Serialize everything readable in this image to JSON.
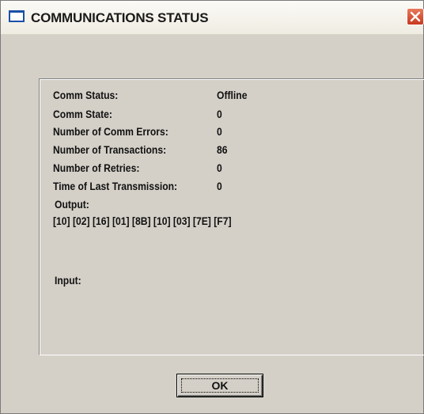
{
  "window": {
    "title": "COMMUNICATIONS STATUS",
    "close_icon": "close-icon"
  },
  "status": {
    "rows": [
      {
        "label": "Comm Status:",
        "value": "Offline"
      },
      {
        "label": "Comm State:",
        "value": "0"
      },
      {
        "label": "Number of Comm Errors:",
        "value": "0"
      },
      {
        "label": "Number of Transactions:",
        "value": "86"
      },
      {
        "label": "Number of Retries:",
        "value": "0"
      },
      {
        "label": "Time of Last Transmission:",
        "value": "0"
      }
    ],
    "output_label": "Output:",
    "output_value": "[10] [02] [16] [01] [8B] [10] [03] [7E] [F7]",
    "input_label": "Input:",
    "input_value": ""
  },
  "buttons": {
    "ok_label": "OK"
  },
  "colors": {
    "dialog_bg": "#d4d0c8",
    "close_button": "#c7391f",
    "title_icon": "#1b4fa8"
  }
}
